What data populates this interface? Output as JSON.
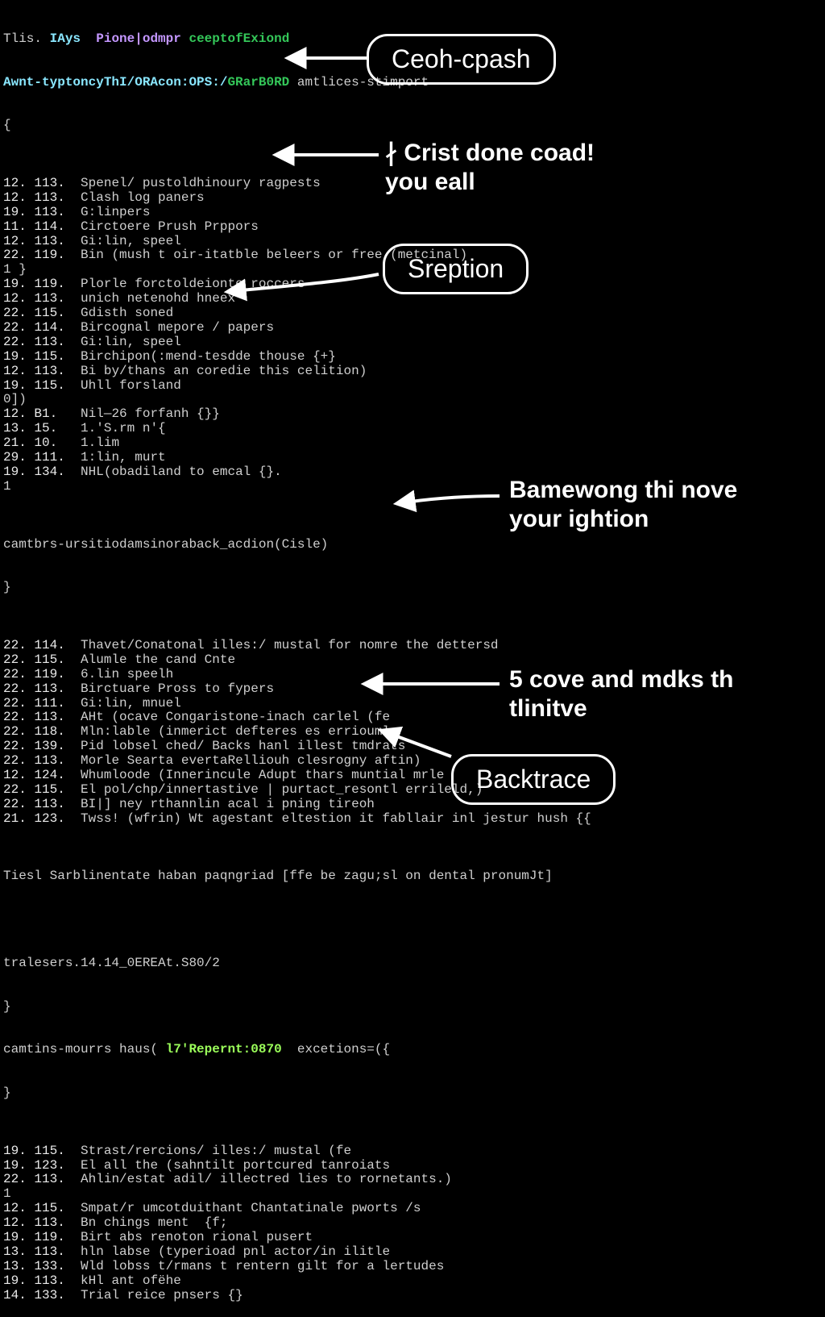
{
  "header": {
    "l1_a": "Tlis.",
    "l1_b": "IAys",
    "l1_c": "Pione|odmpr",
    "l1_d": "ceeptofExiond",
    "l2_a": "Awnt-typtoncyThI/ORAcon:OPS:/",
    "l2_b": "GRarB0RD",
    "l2_c": "amtlices-stimport"
  },
  "block1": [
    {
      "a": "12.",
      "b": "113.",
      "t": "Spenel/ pustoldhinoury ragpests"
    },
    {
      "a": "12.",
      "b": "113.",
      "t": "Clash log paners"
    },
    {
      "a": "19.",
      "b": "113.",
      "t": "G:linpers"
    },
    {
      "a": "11.",
      "b": "114.",
      "t": "Circtoere Prush Prppors"
    },
    {
      "a": "12.",
      "b": "113.",
      "t": "Gi:lin, speel"
    },
    {
      "a": "22.",
      "b": "119.",
      "t": "Bin (mush t oir-itatble beleers or free (metcinal)"
    },
    {
      "a": "1 }",
      "b": "",
      "t": ""
    },
    {
      "a": "19.",
      "b": "119.",
      "t": "Plorle forctoldeionte roccers"
    },
    {
      "a": "12.",
      "b": "113.",
      "t": "unich netenohd hneex"
    },
    {
      "a": "22.",
      "b": "115.",
      "t": "Gdisth soned"
    },
    {
      "a": "22.",
      "b": "114.",
      "t": "Bircognal mepore / papers"
    },
    {
      "a": "22.",
      "b": "113.",
      "t": "Gi:lin, speel"
    },
    {
      "a": "19.",
      "b": "115.",
      "t": "Birchipon(:mend-tesdde thouse {+}"
    },
    {
      "a": "12.",
      "b": "113.",
      "t": "Bi by/thans an coredie this celition)"
    },
    {
      "a": "19.",
      "b": "115.",
      "t": "Uhll forsland"
    },
    {
      "a": "0])",
      "b": "",
      "t": ""
    },
    {
      "a": "12.",
      "b": "B1.",
      "t": "Nil—26 forfanh {}}"
    },
    {
      "a": "13.",
      "b": "15.",
      "t": "1.'S.rm n'{"
    },
    {
      "a": "21.",
      "b": "10.",
      "t": "1.lim"
    },
    {
      "a": "29.",
      "b": "111.",
      "t": "1:lin, murt"
    },
    {
      "a": "19.",
      "b": "134.",
      "t": "NHL(obadiland to emcal {}."
    },
    {
      "a": "1",
      "b": "",
      "t": ""
    }
  ],
  "mid_call": "camtbrs-ursitiodamsinoraback_acdion(Cisle)",
  "block2": [
    {
      "a": "22.",
      "b": "114.",
      "t": "Thavet/Conatonal illes:/ mustal for nomre the dettersd"
    },
    {
      "a": "22.",
      "b": "115.",
      "t": "Alumle the cand Cnte"
    },
    {
      "a": "22.",
      "b": "119.",
      "t": "6.lin speelh"
    },
    {
      "a": "22.",
      "b": "113.",
      "t": "Birctuare Pross to fypers"
    },
    {
      "a": "22.",
      "b": "111.",
      "t": "Gi:lin, mnuel"
    },
    {
      "a": "22.",
      "b": "113.",
      "t": "AHt (ocave Congaristone-inach carlel (fe"
    },
    {
      "a": "22.",
      "b": "118.",
      "t": "Mln:lable (inmerict defteres es errioumle"
    },
    {
      "a": "22.",
      "b": "139.",
      "t": "Pid lobsel ched/ Backs hanl illest tmdrats"
    },
    {
      "a": "22.",
      "b": "113.",
      "t": "Morle Searta evertaRelliouh clesrogny aftin)"
    },
    {
      "a": "12.",
      "b": "124.",
      "t": "Whumloode (Innerincule Adupt thars muntial mrle"
    },
    {
      "a": "22.",
      "b": "115.",
      "t": "El pol/chp/innertastive | purtact_resontl errileld,)"
    },
    {
      "a": "22.",
      "b": "113.",
      "t": "BI|] ney rthannlin acal i pning tireoh"
    },
    {
      "a": "21.",
      "b": "123.",
      "t": "Twss! (wfrin) Wt agestant eltestion it fabllair inl jestur hush {{"
    }
  ],
  "tail1": "Tiesl Sarblinentate haban paqngriad [ffe be zagu;sl on dental pronumJt]",
  "tail2": "tralesers.14.14_0EREAt.S80/2",
  "call2_a": "camtins-mourrs haus(",
  "call2_b": "l7'Repernt:0870",
  "call2_c": "excetions=({",
  "block3": [
    {
      "a": "19.",
      "b": "115.",
      "t": "Strast/rercions/ illes:/ mustal (fe"
    },
    {
      "a": "19.",
      "b": "123.",
      "t": "El all the (sahntilt portcured tanroiats"
    },
    {
      "a": "22.",
      "b": "113.",
      "t": "Ahlin/estat adil/ illectred lies to rornetants.)"
    },
    {
      "a": "1",
      "b": "",
      "t": ""
    },
    {
      "a": "12.",
      "b": "115.",
      "t": "Smpat/r umcotduithant Chantatinale pworts /s"
    },
    {
      "a": "12.",
      "b": "113.",
      "t": "Bn chings ment  {f;"
    },
    {
      "a": "19.",
      "b": "119.",
      "t": "Birt abs renoton rional pusert"
    },
    {
      "a": "13.",
      "b": "113.",
      "t": "hln labse (typerioad pnl actor/in ilitle"
    },
    {
      "a": "13.",
      "b": "133.",
      "t": "Wld lobss t/rmans t rentern gilt for a lertudes"
    },
    {
      "a": "19.",
      "b": "113.",
      "t": "kHl ant ofëhe"
    },
    {
      "a": "14.",
      "b": "133.",
      "t": "Trial reice pnsers {}"
    }
  ],
  "callouts": {
    "pill1": "Ceoh-cpash",
    "note1": "∤ Crist done coad!\nyou eall",
    "pill2": "Sreption",
    "note2": "Bamewong thi nove\nyour ightion",
    "note3": "5 cove and mdks th\ntlinitve",
    "pill3": "Backtrace"
  }
}
